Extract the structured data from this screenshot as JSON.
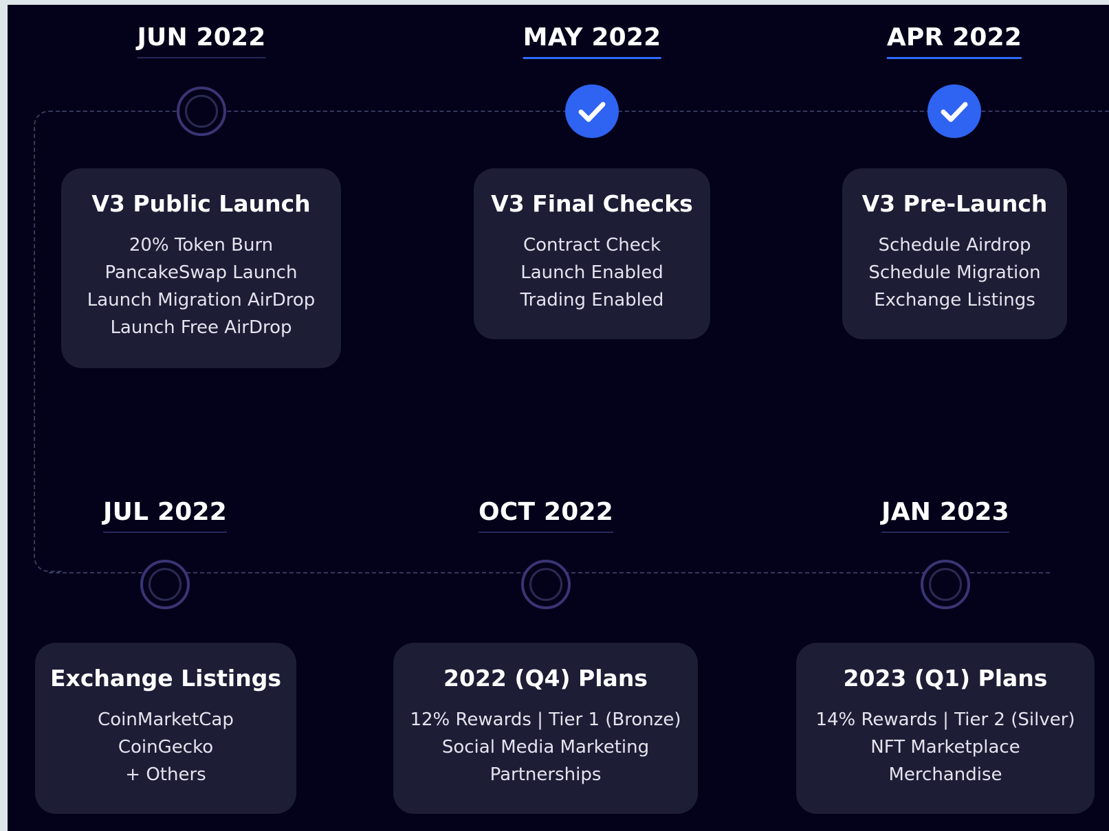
{
  "colors": {
    "page_background": "#dfe6ea",
    "panel_background": "#04021a",
    "card_background": "#1d1d36",
    "accent_blue": "#2f63f2",
    "pending_ring": "#3a3574",
    "text": "#ffffff"
  },
  "top_row": [
    {
      "date": "JUN 2022",
      "status": "pending",
      "title": "V3 Public Launch",
      "items": [
        "20% Token Burn",
        "PancakeSwap Launch",
        "Launch Migration AirDrop",
        "Launch Free AirDrop"
      ]
    },
    {
      "date": "MAY 2022",
      "status": "completed",
      "status_icon": "check-icon",
      "title": "V3 Final Checks",
      "items": [
        "Contract Check",
        "Launch Enabled",
        "Trading Enabled"
      ]
    },
    {
      "date": "APR 2022",
      "status": "completed",
      "status_icon": "check-icon",
      "title": "V3 Pre-Launch",
      "items": [
        "Schedule Airdrop",
        "Schedule Migration",
        "Exchange Listings"
      ]
    }
  ],
  "bottom_row": [
    {
      "date": "JUL 2022",
      "status": "pending",
      "title": "Exchange Listings",
      "items": [
        "CoinMarketCap",
        "CoinGecko",
        "+ Others"
      ]
    },
    {
      "date": "OCT 2022",
      "status": "pending",
      "title": "2022 (Q4) Plans",
      "items": [
        "12% Rewards | Tier 1 (Bronze)",
        "Social Media Marketing",
        "Partnerships"
      ]
    },
    {
      "date": "JAN 2023",
      "status": "pending",
      "title": "2023 (Q1) Plans",
      "items": [
        "14% Rewards | Tier 2 (Silver)",
        "NFT Marketplace",
        "Merchandise"
      ]
    }
  ]
}
